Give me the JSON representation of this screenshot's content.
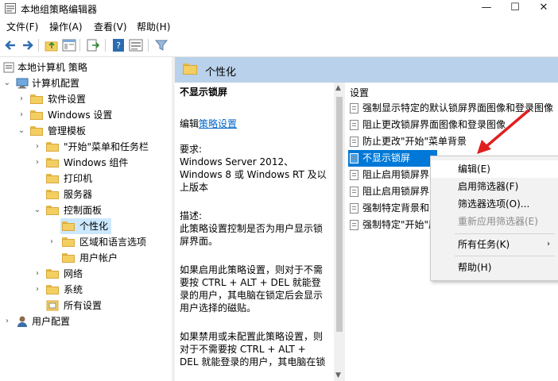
{
  "window": {
    "title": "本地组策略编辑器"
  },
  "menu": [
    "文件(F)",
    "操作(A)",
    "查看(V)",
    "帮助(H)"
  ],
  "tree": {
    "root": "本地计算机 策略",
    "computer_config": "计算机配置",
    "software_settings": "软件设置",
    "windows_settings": "Windows 设置",
    "admin_templates": "管理模板",
    "start_menu": "\"开始\"菜单和任务栏",
    "windows_components": "Windows 组件",
    "printers": "打印机",
    "servers": "服务器",
    "control_panel": "控制面板",
    "personalization": "个性化",
    "region_language": "区域和语言选项",
    "user_accounts": "用户帐户",
    "network": "网络",
    "system": "系统",
    "all_settings": "所有设置",
    "user_config": "用户配置"
  },
  "header": {
    "title": "个性化"
  },
  "description": {
    "title": "不显示锁屏",
    "edit_prefix": "编辑",
    "edit_link": "策略设置",
    "requirements_label": "要求:",
    "requirements_l1": "Windows Server 2012、",
    "requirements_l2": "Windows 8 或 Windows RT 及以",
    "requirements_l3": "上版本",
    "desc_label": "描述:",
    "desc_l1": "此策略设置控制是否为用户显示锁",
    "desc_l2": "屏界面。",
    "enabled_l1": "如果启用此策略设置，则对于不需",
    "enabled_l2": "要按 CTRL + ALT + DEL 就能登",
    "enabled_l3": "录的用户，其电脑在锁定后会显示",
    "enabled_l4": "用户选择的磁贴。",
    "disabled_l1": "如果禁用或未配置此策略设置，则",
    "disabled_l2": "对于不需要按 CTRL + ALT +",
    "disabled_l3": "DEL 就能登录的用户，其电脑在锁"
  },
  "settings": {
    "header": "设置",
    "rows": [
      "强制显示特定的默认锁屏界面图像和登录图像",
      "阻止更改锁屏界面图像和登录图像",
      "防止更改\"开始\"菜单背景",
      "不显示锁屏",
      "阻止启用锁屏界",
      "阻止启用锁屏界",
      "强制特定背景和",
      "强制特定\"开始\"屏"
    ]
  },
  "context_menu": {
    "edit": "编辑(E)",
    "enable_filter": "启用筛选器(F)",
    "filter_options": "筛选器选项(O)...",
    "reapply_filter": "重新应用筛选器(E)",
    "all_tasks": "所有任务(K)",
    "help": "帮助(H)"
  },
  "colors": {
    "selection": "#0078d7",
    "header_bar": "#b9d1ea",
    "annotation_arrow": "#e02020",
    "link": "#0066cc"
  },
  "icons": [
    "app-icon",
    "back-arrow-icon",
    "forward-arrow-icon",
    "folder-up-icon",
    "show-hide-tree-icon",
    "export-list-icon",
    "help-icon",
    "properties-icon",
    "filter-icon",
    "folder-icon",
    "policy-setting-icon",
    "computer-icon",
    "user-icon"
  ]
}
